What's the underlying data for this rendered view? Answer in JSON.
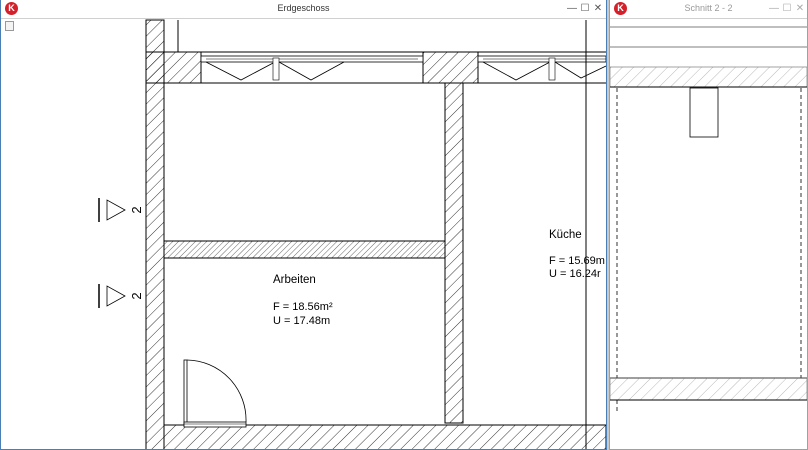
{
  "windows": {
    "plan": {
      "title": "Erdgeschoss",
      "controls": {
        "minimize": "—",
        "maximize": "☐",
        "close": "✕"
      }
    },
    "section": {
      "title": "Schnitt 2 - 2",
      "controls": {
        "minimize": "—",
        "maximize": "☐",
        "close": "✕"
      }
    }
  },
  "app_icon_letter": "K",
  "section_markers": [
    {
      "label": "2"
    },
    {
      "label": "2"
    }
  ],
  "rooms": {
    "arbeiten": {
      "name": "Arbeiten",
      "area": "F = 18.56m²",
      "perimeter": "U = 17.48m"
    },
    "kueche": {
      "name": "Küche",
      "area": "F = 15.69m",
      "perimeter": "U = 16.24r"
    }
  }
}
